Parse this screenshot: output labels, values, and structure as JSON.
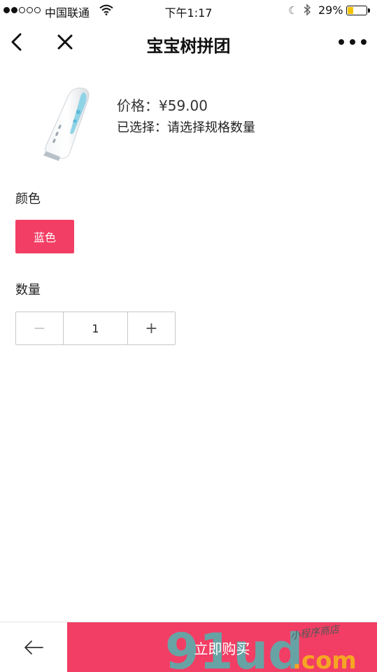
{
  "status_bar": {
    "carrier": "中国联通",
    "time": "下午1:17",
    "battery_percent": "29%",
    "battery_level": 0.29,
    "signal_filled": 2,
    "signal_total": 5
  },
  "nav": {
    "title": "宝宝树拼团",
    "back_icon": "chevron-left-icon",
    "close_icon": "close-icon",
    "more_icon": "more-dots-icon"
  },
  "product": {
    "price": "价格：¥59.00",
    "selected": "已选择：请选择规格数量"
  },
  "spec": {
    "color_label": "颜色",
    "color_option": "蓝色",
    "quantity_label": "数量",
    "quantity_value": "1",
    "minus": "−",
    "plus": "+"
  },
  "bottom": {
    "back_icon": "arrow-left-icon",
    "buy_label": "立即购买"
  },
  "watermark": {
    "main": "91ud",
    "suffix": ".com",
    "tagline": "小程序商店"
  },
  "colors": {
    "accent": "#f23e64",
    "battery": "#f2c400",
    "watermark_teal": "#4fb5b0",
    "watermark_green": "#7bd05a",
    "watermark_orange": "#f5a623"
  }
}
